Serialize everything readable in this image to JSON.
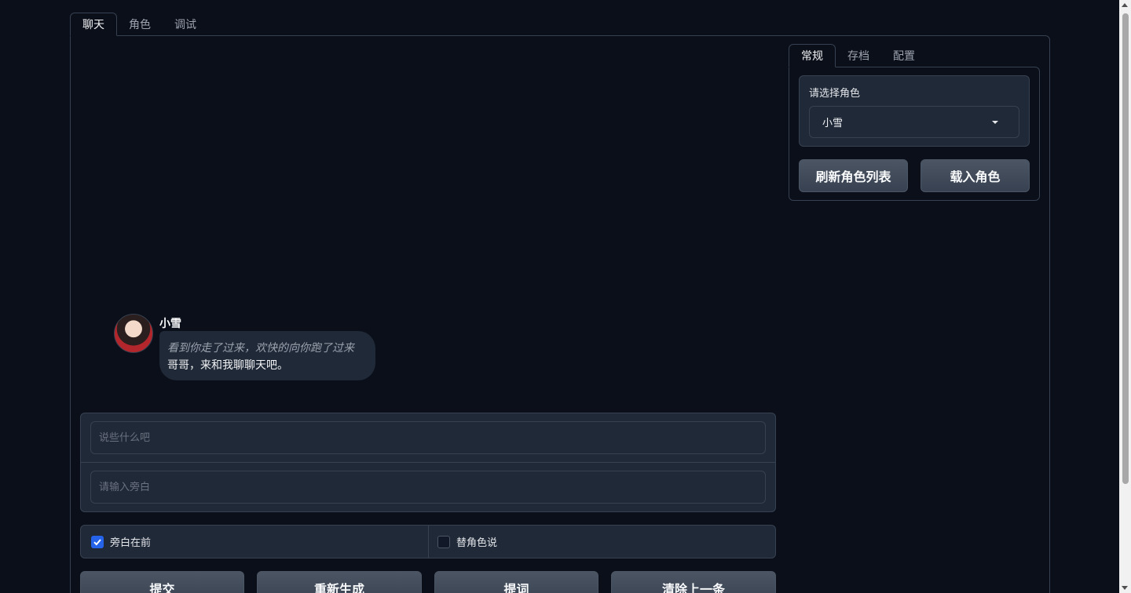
{
  "tabs": [
    "聊天",
    "角色",
    "调试"
  ],
  "side_tabs": [
    "常规",
    "存档",
    "配置"
  ],
  "character_select": {
    "label": "请选择角色",
    "value": "小雪"
  },
  "buttons": {
    "refresh": "刷新角色列表",
    "load": "载入角色"
  },
  "chat": {
    "sender": "小雪",
    "narration": "看到你走了过来，欢快的向你跑了过来",
    "speech": "哥哥，来和我聊聊天吧。"
  },
  "inputs": {
    "message_placeholder": "说些什么吧",
    "narration_placeholder": "请输入旁白"
  },
  "checkboxes": {
    "narration_first": "旁白在前",
    "speak_for_character": "替角色说"
  },
  "actions": {
    "submit": "提交",
    "regenerate": "重新生成",
    "prompt": "提词",
    "clear_last": "清除上一条"
  }
}
